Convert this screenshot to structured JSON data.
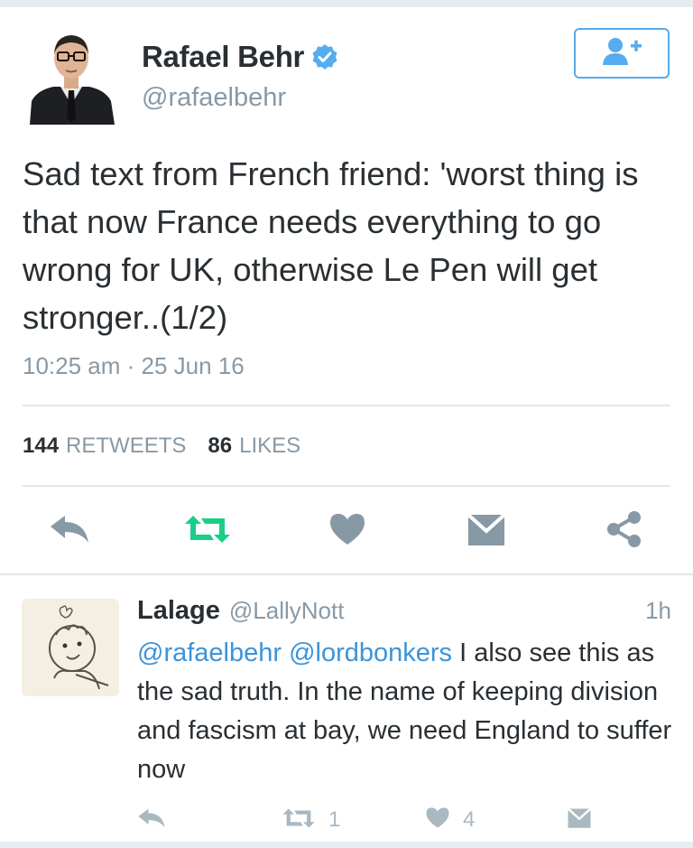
{
  "tweet": {
    "author_name": "Rafael Behr",
    "author_handle": "@rafaelbehr",
    "text": "Sad text from French friend: 'worst thing is that now France needs everything to go wrong for UK, otherwise Le Pen will get stronger..(1/2)",
    "timestamp": "10:25 am · 25 Jun 16",
    "retweets_count": "144",
    "retweets_label": "RETWEETS",
    "likes_count": "86",
    "likes_label": "LIKES"
  },
  "reply": {
    "author_name": "Lalage",
    "author_handle": "@LallyNott",
    "time": "1h",
    "mention_1": "@rafaelbehr",
    "mention_2": "@lordbonkers",
    "text": " I also see this as the sad truth. In the name of keeping division and fascism at bay, we need England to suffer now",
    "retweet_count": "1",
    "like_count": "4"
  },
  "colors": {
    "accent": "#55acee",
    "retweet_active": "#19cf86",
    "icon_gray": "#8899a6",
    "text": "#292f33"
  },
  "icons": [
    "verified-badge-icon",
    "follow-user-plus-icon",
    "reply-icon",
    "retweet-icon",
    "like-heart-icon",
    "direct-message-icon",
    "share-icon"
  ]
}
